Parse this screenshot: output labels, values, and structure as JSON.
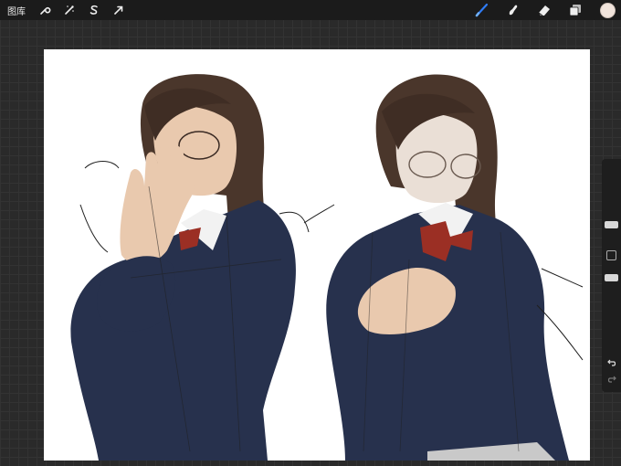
{
  "toolbar": {
    "gallery_label": "图库",
    "left_tools": [
      {
        "name": "actions-wrench-icon"
      },
      {
        "name": "adjustments-wand-icon"
      },
      {
        "name": "selection-s-icon"
      },
      {
        "name": "transform-arrow-icon"
      }
    ],
    "right_tools": [
      {
        "name": "brush-icon",
        "active_color": "#2f7cf6"
      },
      {
        "name": "smudge-icon"
      },
      {
        "name": "eraser-icon"
      },
      {
        "name": "layers-icon"
      }
    ],
    "current_color": "#f1e4dc"
  },
  "canvas": {
    "background": "#ffffff",
    "colors": {
      "hair": "#4a362b",
      "blazer": "#27314d",
      "skin": "#e9c9ae",
      "bow": "#9b2f24",
      "line": "#1f1f1f"
    }
  },
  "sidebar": {
    "brush_size_level": 0.3,
    "opacity_level": 0.5
  }
}
